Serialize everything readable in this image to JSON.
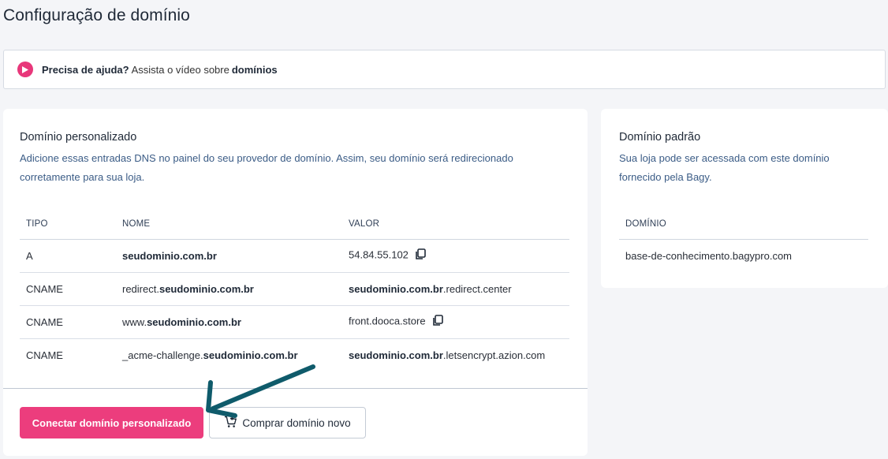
{
  "page": {
    "title": "Configuração de domínio"
  },
  "help": {
    "lead": "Precisa de ajuda?",
    "middle": "Assista o vídeo sobre",
    "topic": "domínios"
  },
  "custom_domain": {
    "title": "Domínio personalizado",
    "description": "Adicione essas entradas DNS no painel do seu provedor de domínio. Assim, seu domínio será redirecionado corretamente para sua loja.",
    "columns": [
      "TIPO",
      "NOME",
      "VALOR"
    ],
    "rows": [
      {
        "type": "A",
        "name_prefix": "",
        "name_bold": "seudominio.com.br",
        "value_bold": "",
        "value_rest": "54.84.55.102",
        "copy": true
      },
      {
        "type": "CNAME",
        "name_prefix": "redirect.",
        "name_bold": "seudominio.com.br",
        "value_bold": "seudominio.com.br",
        "value_rest": ".redirect.center",
        "copy": false
      },
      {
        "type": "CNAME",
        "name_prefix": "www.",
        "name_bold": "seudominio.com.br",
        "value_bold": "",
        "value_rest": "front.dooca.store",
        "copy": true
      },
      {
        "type": "CNAME",
        "name_prefix": "_acme-challenge.",
        "name_bold": "seudominio.com.br",
        "value_bold": "seudominio.com.br",
        "value_rest": ".letsencrypt.azion.com",
        "copy": false
      }
    ],
    "connect_button": "Conectar domínio personalizado",
    "buy_button": "Comprar domínio novo"
  },
  "default_domain": {
    "title": "Domínio padrão",
    "description": "Sua loja pode ser acessada com este domínio fornecido pela Bagy.",
    "column": "DOMÍNIO",
    "value": "base-de-conhecimento.bagypro.com"
  },
  "colors": {
    "accent": "#ec3d7d",
    "annotation_arrow": "#0f5b6b",
    "description_text": "#3b5c86"
  },
  "icons": {
    "play": "play-icon",
    "copy": "copy-icon",
    "cart": "cart-add-icon",
    "annotation": "arrow-annotation-icon"
  }
}
